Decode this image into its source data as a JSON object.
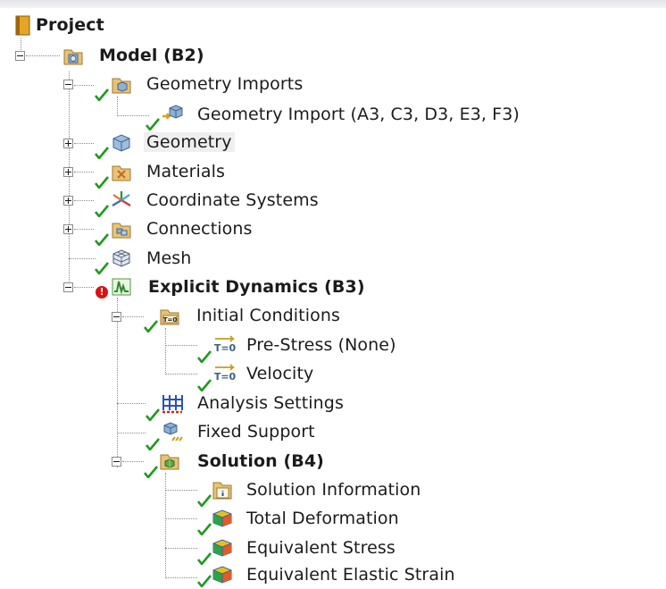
{
  "tree": {
    "project": "Project",
    "model": "Model (B2)",
    "geometry_imports": "Geometry Imports",
    "geometry_import": "Geometry Import (A3, C3, D3, E3, F3)",
    "geometry": "Geometry",
    "materials": "Materials",
    "coordinate_systems": "Coordinate Systems",
    "connections": "Connections",
    "mesh": "Mesh",
    "explicit_dynamics": "Explicit Dynamics (B3)",
    "error_mark": "!",
    "initial_conditions": "Initial Conditions",
    "pre_stress": "Pre-Stress (None)",
    "velocity": "Velocity",
    "analysis_settings": "Analysis Settings",
    "fixed_support": "Fixed Support",
    "solution": "Solution (B4)",
    "solution_information": "Solution Information",
    "total_deformation": "Total Deformation",
    "equivalent_stress": "Equivalent Stress",
    "equivalent_elastic_strain": "Equivalent Elastic Strain",
    "t0_badge": "T=0"
  },
  "colors": {
    "check": "#1f9a1f",
    "error": "#dd1111",
    "folder": "#d9a93a",
    "cube": "#7fa8d8"
  }
}
